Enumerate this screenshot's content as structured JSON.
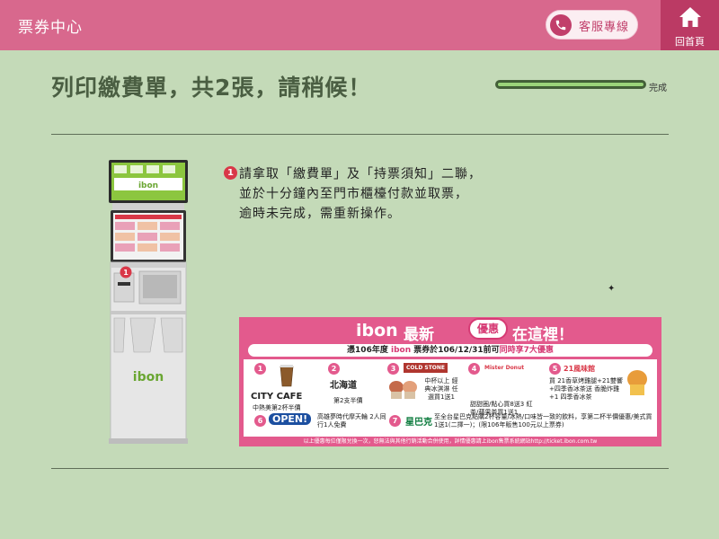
{
  "header": {
    "title": "票券中心",
    "customer_service_label": "客服專線",
    "home_label": "回首頁",
    "colors": {
      "bar": "#d8688d",
      "home": "#bb3a64"
    }
  },
  "main": {
    "title": "列印繳費單，共2張，請稍候！",
    "progress": {
      "label": "完成",
      "value": 1.0
    }
  },
  "instruction": {
    "step": "1",
    "lines": [
      "請拿取「繳費單」及「持票須知」二聯，",
      "並於十分鐘內至門市櫃檯付款並取票，",
      "逾時未完成，需重新操作。"
    ]
  },
  "kiosk": {
    "step": "1",
    "brand": "ibon"
  },
  "banner": {
    "logo": "ibon",
    "head_left": "最新",
    "head_badge": "優惠",
    "head_right": "在這裡！",
    "subtitle_pre": "憑106年度",
    "subtitle_logo": "ibon",
    "subtitle_mid": "票券於106/12/31前可",
    "subtitle_hl": "同時享7大優惠",
    "promos": [
      {
        "num": "1",
        "brand": "CITY CAFE",
        "text": "中熱美第2杯半價"
      },
      {
        "num": "2",
        "brand": "北海道",
        "text": "第2支半價"
      },
      {
        "num": "3",
        "brand": "COLD STONE",
        "text": "中杯以上 經典冰淇淋 任選買1送1"
      },
      {
        "num": "4",
        "brand": "Mister Donut",
        "text": "甜甜圈/點心買8送3 紅茶/蘋果茶買1送1"
      },
      {
        "num": "5",
        "brand": "21風味館",
        "text": "買 21香草烤雞腿+21雙響+四季香冰茶送 香脆炸雞+1 四季香冰茶"
      },
      {
        "num": "6",
        "brand": "OPEN!",
        "text": "高雄夢時代摩天輪 2人同行1人免費"
      },
      {
        "num": "7",
        "brand": "星巴克",
        "text": "至全台星巴克點購2杯容量/冰熱/口味皆一致的飲料，享第二杯半價優惠/美式買1送1(二擇一)；(限106年販售100元以上票券)"
      }
    ],
    "footer": "以上優惠每位僅限兌換一次，恕無法與其他行銷活動合併使用，詳情優惠請上ibon售票系統網站http://ticket.ibon.com.tw"
  }
}
